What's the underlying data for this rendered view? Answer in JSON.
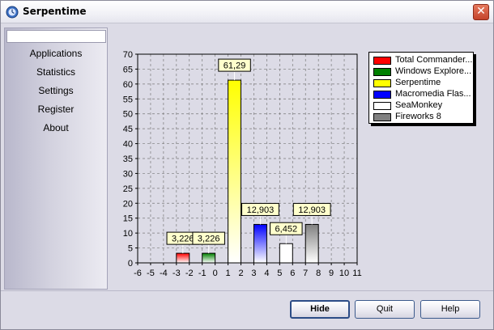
{
  "window": {
    "title": "Serpentime"
  },
  "sidebar": {
    "items": [
      {
        "label": "Applications"
      },
      {
        "label": "Statistics"
      },
      {
        "label": "Settings"
      },
      {
        "label": "Register"
      },
      {
        "label": "About"
      }
    ]
  },
  "buttons": {
    "hide": "Hide",
    "quit": "Quit",
    "help": "Help"
  },
  "chart_data": {
    "type": "bar",
    "xlim": [
      -6,
      11
    ],
    "ylim": [
      0,
      70
    ],
    "x_ticks": [
      -6,
      -5,
      -4,
      -3,
      -2,
      -1,
      0,
      1,
      2,
      3,
      4,
      5,
      6,
      7,
      8,
      9,
      10,
      11
    ],
    "y_ticks": [
      0,
      5,
      10,
      15,
      20,
      25,
      30,
      35,
      40,
      45,
      50,
      55,
      60,
      65,
      70
    ],
    "grid": true,
    "legend_position": "top-right",
    "series": [
      {
        "name": "Total Commander...",
        "x": -2.5,
        "value": 3.226,
        "label": "3,226",
        "color": "#ff0000"
      },
      {
        "name": "Windows Explore...",
        "x": -0.5,
        "value": 3.226,
        "label": "3,226",
        "color": "#008000"
      },
      {
        "name": "Serpentime",
        "x": 1.5,
        "value": 61.29,
        "label": "61,29",
        "color": "#ffff00"
      },
      {
        "name": "Macromedia Flas...",
        "x": 3.5,
        "value": 12.903,
        "label": "12,903",
        "color": "#0000ff"
      },
      {
        "name": "SeaMonkey",
        "x": 5.5,
        "value": 6.452,
        "label": "6,452",
        "color": "#ffffff"
      },
      {
        "name": "Fireworks 8",
        "x": 7.5,
        "value": 12.903,
        "label": "12,903",
        "color": "#808080"
      }
    ]
  }
}
